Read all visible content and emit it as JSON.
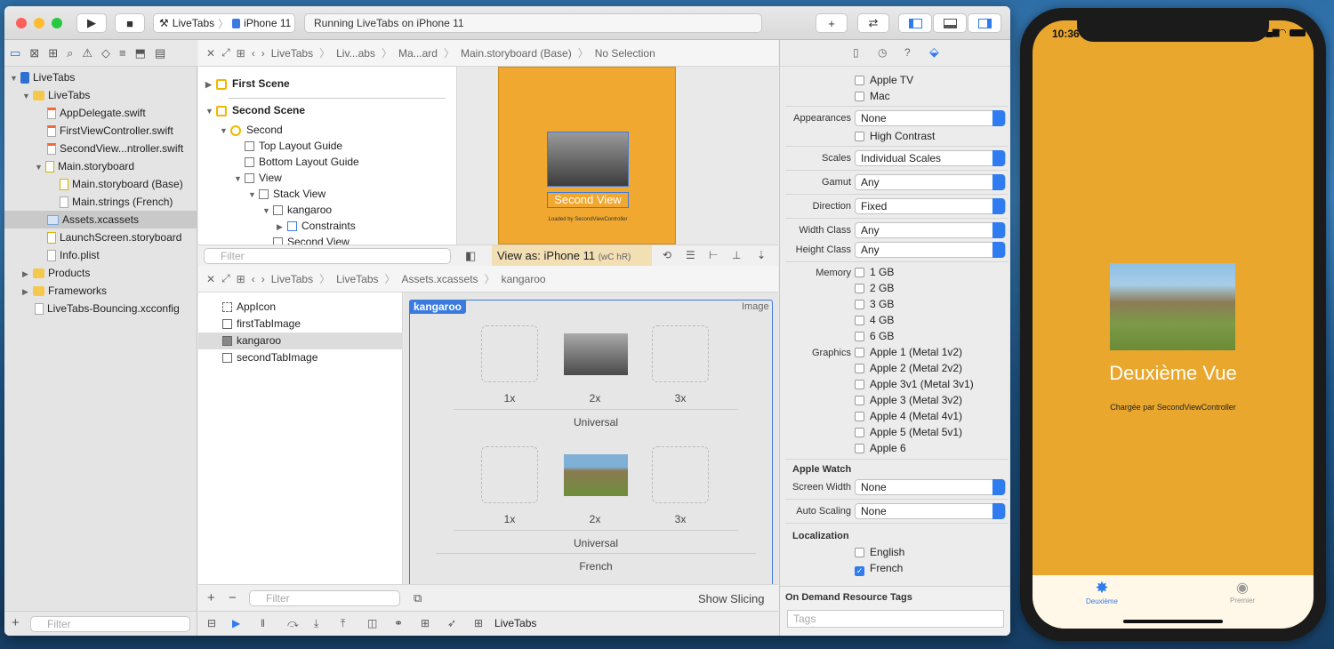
{
  "toolbar": {
    "scheme_target": "LiveTabs",
    "scheme_device": "iPhone 11",
    "status": "Running LiveTabs on iPhone 11"
  },
  "navigator": {
    "items": [
      {
        "label": "LiveTabs",
        "icon": "project-icon",
        "depth": 0,
        "open": true
      },
      {
        "label": "LiveTabs",
        "icon": "folder-icon",
        "depth": 1,
        "open": true
      },
      {
        "label": "AppDelegate.swift",
        "icon": "swift-file-icon",
        "depth": 2
      },
      {
        "label": "FirstViewController.swift",
        "icon": "swift-file-icon",
        "depth": 2
      },
      {
        "label": "SecondView...ntroller.swift",
        "icon": "swift-file-icon",
        "depth": 2
      },
      {
        "label": "Main.storyboard",
        "icon": "storyboard-icon",
        "depth": 2,
        "open": true
      },
      {
        "label": "Main.storyboard (Base)",
        "icon": "storyboard-icon",
        "depth": 3
      },
      {
        "label": "Main.strings (French)",
        "icon": "strings-file-icon",
        "depth": 3
      },
      {
        "label": "Assets.xcassets",
        "icon": "assets-icon",
        "depth": 2,
        "selected": true
      },
      {
        "label": "LaunchScreen.storyboard",
        "icon": "storyboard-icon",
        "depth": 2
      },
      {
        "label": "Info.plist",
        "icon": "plist-icon",
        "depth": 2
      },
      {
        "label": "Products",
        "icon": "folder-icon",
        "depth": 1,
        "open": false
      },
      {
        "label": "Frameworks",
        "icon": "folder-icon",
        "depth": 1,
        "open": false
      },
      {
        "label": "LiveTabs-Bouncing.xcconfig",
        "icon": "config-file-icon",
        "depth": 1
      }
    ],
    "filter_placeholder": "Filter"
  },
  "ib": {
    "jump": [
      "LiveTabs",
      "Liv...abs",
      "Ma...ard",
      "Main.storyboard (Base)",
      "No Selection"
    ],
    "outline": [
      {
        "label": "First Scene",
        "bold": true,
        "depth": 0
      },
      {
        "label": "Second Scene",
        "bold": true,
        "depth": 0
      },
      {
        "label": "Second",
        "depth": 1
      },
      {
        "label": "Top Layout Guide",
        "depth": 2
      },
      {
        "label": "Bottom Layout Guide",
        "depth": 2
      },
      {
        "label": "View",
        "depth": 2
      },
      {
        "label": "Stack View",
        "depth": 3
      },
      {
        "label": "kangaroo",
        "depth": 4
      },
      {
        "label": "Constraints",
        "depth": 5
      },
      {
        "label": "Second View",
        "depth": 4
      }
    ],
    "filter_placeholder": "Filter",
    "canvas_title": "Second View",
    "canvas_subtitle": "Loaded by SecondViewController",
    "view_as": "View as: iPhone 11",
    "size_class": "(wC hR)"
  },
  "assets": {
    "jump": [
      "LiveTabs",
      "LiveTabs",
      "Assets.xcassets",
      "kangaroo"
    ],
    "list": [
      {
        "label": "AppIcon"
      },
      {
        "label": "firstTabImage"
      },
      {
        "label": "kangaroo",
        "selected": true
      },
      {
        "label": "secondTabImage"
      }
    ],
    "set_name": "kangaroo",
    "set_kind": "Image",
    "scales": [
      "1x",
      "2x",
      "3x"
    ],
    "group1": "Universal",
    "group2": "Universal",
    "group3": "French",
    "filter_placeholder": "Filter",
    "show_slicing": "Show Slicing"
  },
  "debug": {
    "target": "LiveTabs"
  },
  "inspector": {
    "devices": [
      "Apple TV",
      "Mac"
    ],
    "appearances_label": "Appearances",
    "appearances_value": "None",
    "high_contrast": "High Contrast",
    "scales_label": "Scales",
    "scales_value": "Individual Scales",
    "gamut_label": "Gamut",
    "gamut_value": "Any",
    "direction_label": "Direction",
    "direction_value": "Fixed",
    "width_label": "Width Class",
    "width_value": "Any",
    "height_label": "Height Class",
    "height_value": "Any",
    "memory_label": "Memory",
    "memory": [
      "1 GB",
      "2 GB",
      "3 GB",
      "4 GB",
      "6 GB"
    ],
    "graphics_label": "Graphics",
    "graphics": [
      "Apple 1 (Metal 1v2)",
      "Apple 2 (Metal 2v2)",
      "Apple 3v1 (Metal 3v1)",
      "Apple 3 (Metal 3v2)",
      "Apple 4 (Metal 4v1)",
      "Apple 5 (Metal 5v1)",
      "Apple 6"
    ],
    "watch_head": "Apple Watch",
    "screen_width_label": "Screen Width",
    "screen_width_value": "None",
    "auto_scaling_label": "Auto Scaling",
    "auto_scaling_value": "None",
    "loc_head": "Localization",
    "loc": [
      {
        "label": "English",
        "checked": false
      },
      {
        "label": "French",
        "checked": true
      }
    ],
    "odr_head": "On Demand Resource Tags",
    "tags_placeholder": "Tags"
  },
  "phone": {
    "time": "10:36",
    "title": "Deuxième Vue",
    "subtitle": "Chargée par SecondViewController",
    "tab1": "Deuxième",
    "tab2": "Premier"
  },
  "colors": {
    "accent": "#2f7bf0",
    "orange": "#e9a72e"
  }
}
